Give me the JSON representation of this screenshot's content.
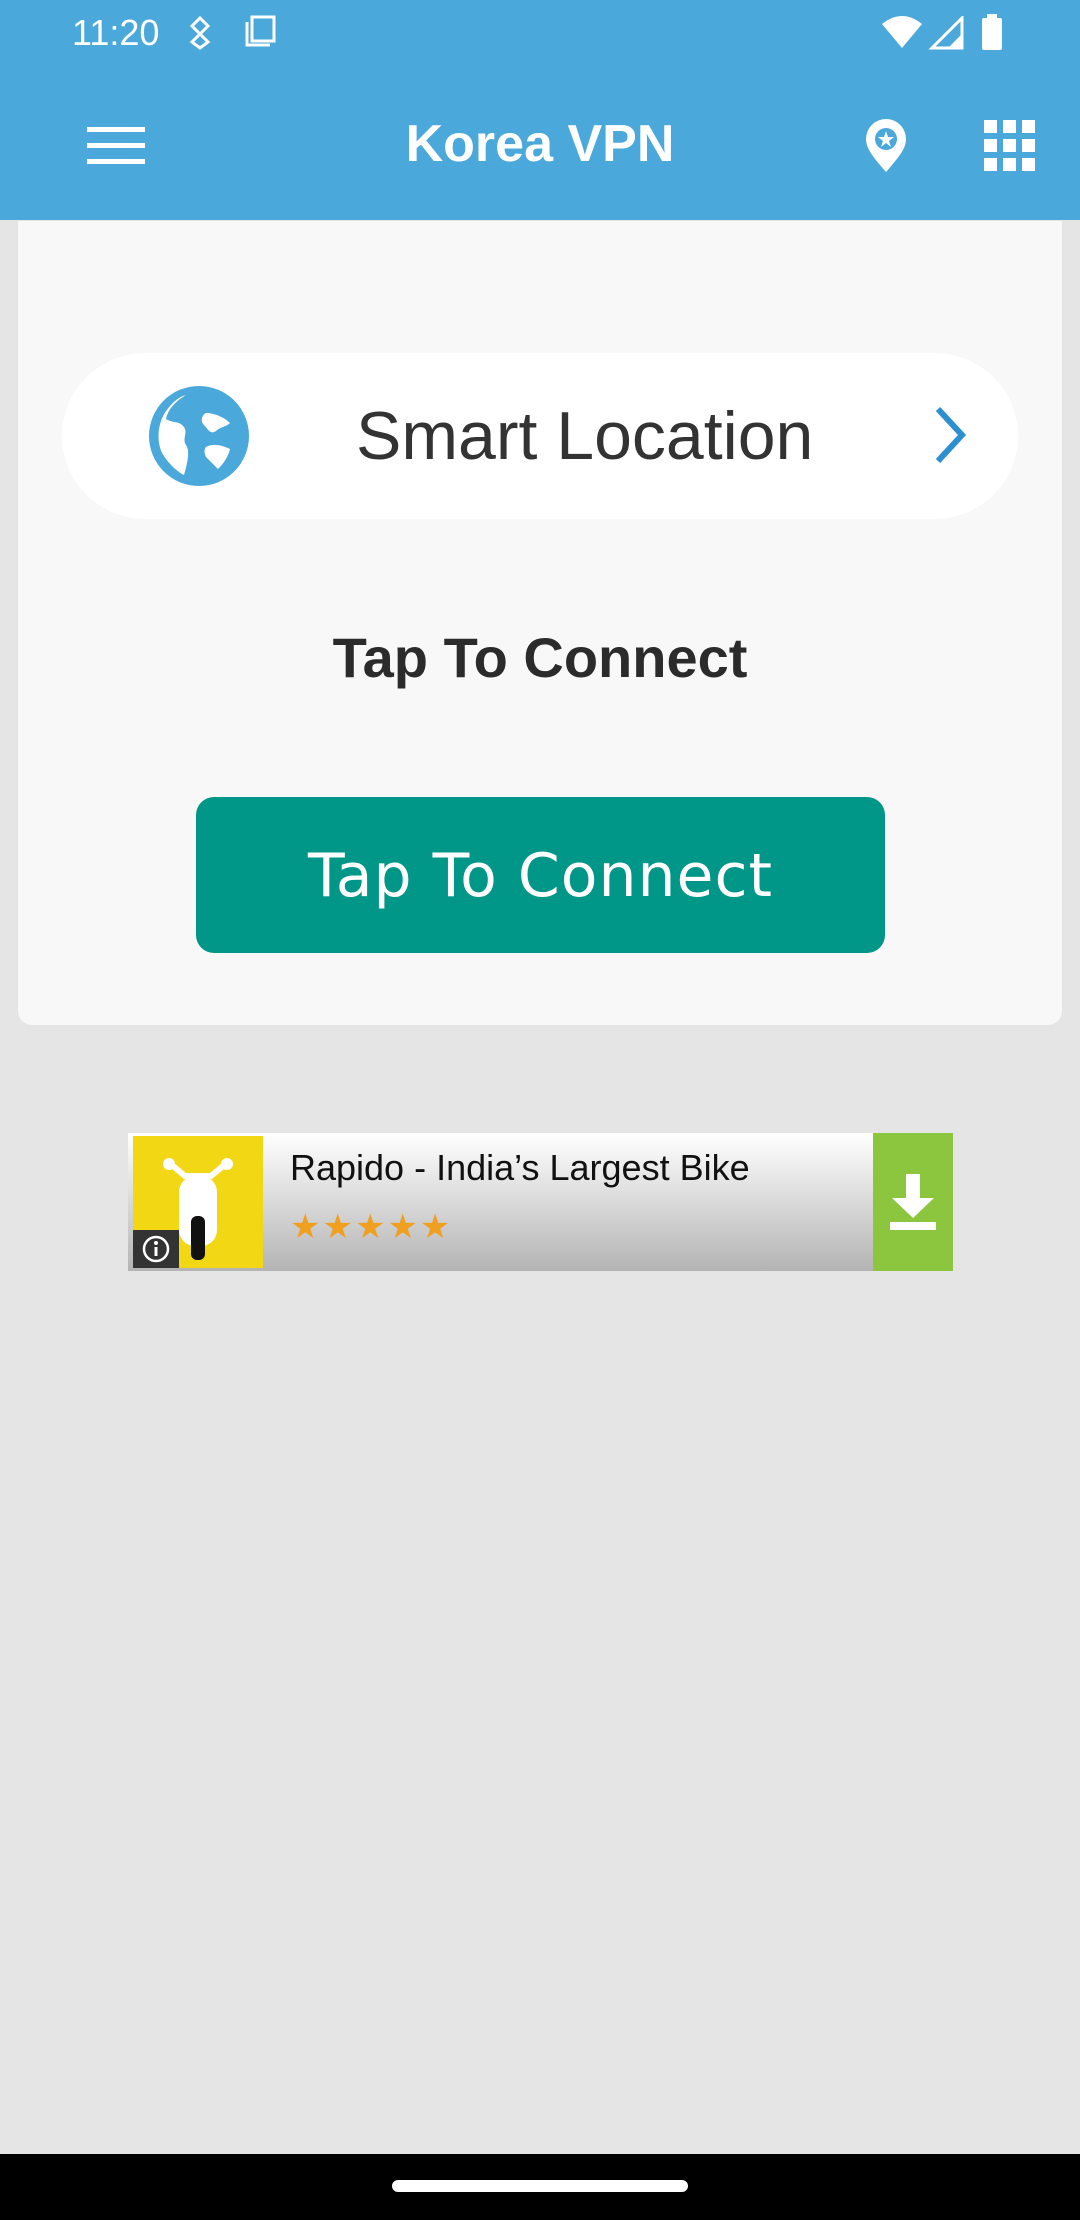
{
  "status_bar": {
    "time": "11:20",
    "icons": [
      "data-saver-icon",
      "screenshot-icon",
      "wifi-icon",
      "signal-icon",
      "battery-icon"
    ]
  },
  "app_bar": {
    "title": "Korea VPN",
    "menu_icon": "hamburger-menu-icon",
    "location_icon": "location-pin-icon",
    "apps_icon": "grid-apps-icon",
    "color": "#4aa8db"
  },
  "location_selector": {
    "label": "Smart Location",
    "icon": "globe-icon",
    "chevron": "chevron-right-icon"
  },
  "connection": {
    "status_text": "Tap To Connect",
    "button_label": "Tap To Connect",
    "button_color": "#009688"
  },
  "ad": {
    "title": "Rapido - India’s Largest Bike",
    "stars": "★★★★★",
    "rating": 4.5,
    "info_icon": "info-icon",
    "download_icon": "download-icon",
    "accent": "#8cc63f"
  }
}
